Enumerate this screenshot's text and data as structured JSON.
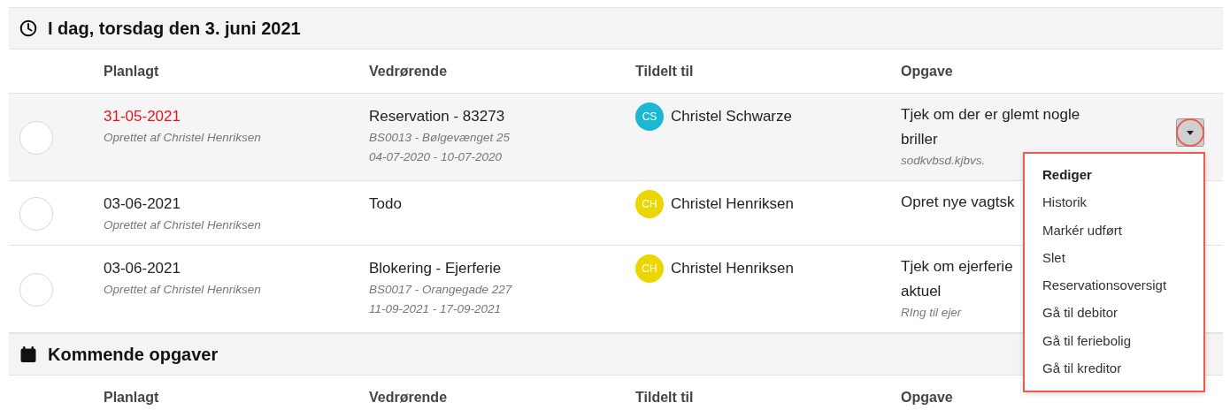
{
  "sections": [
    {
      "title": "I dag, torsdag den 3. juni 2021",
      "columns": [
        "Planlagt",
        "Vedrørende",
        "Tildelt til",
        "Opgave"
      ],
      "rows": [
        {
          "checked": false,
          "hovered": true,
          "date": "31-05-2021",
          "overdue": true,
          "created_by": "Oprettet af Christel Henriksen",
          "subject": "Reservation - 83273",
          "subject_details": [
            "BS0013 - Bølgevænget 25",
            "04-07-2020 - 10-07-2020"
          ],
          "assignee": {
            "initials": "CS",
            "name": "Christel Schwarze",
            "color": "#1bb8d6"
          },
          "task": "Tjek om der er glemt nogle briller",
          "task_note": "sodkvbsd.kjbvs."
        },
        {
          "checked": false,
          "date": "03-06-2021",
          "overdue": false,
          "created_by": "Oprettet af Christel Henriksen",
          "subject": "Todo",
          "subject_details": [],
          "assignee": {
            "initials": "CH",
            "name": "Christel Henriksen",
            "color": "#ecd600"
          },
          "task": "Opret nye vagtsk"
        },
        {
          "checked": false,
          "date": "03-06-2021",
          "overdue": false,
          "created_by": "Oprettet af Christel Henriksen",
          "subject": "Blokering - Ejerferie",
          "subject_details": [
            "BS0017 - Orangegade 227",
            "11-09-2021 - 17-09-2021"
          ],
          "assignee": {
            "initials": "CH",
            "name": "Christel Henriksen",
            "color": "#ecd600"
          },
          "task": "Tjek om ejerferie\naktuel",
          "task_note": "RIng til ejer"
        }
      ]
    },
    {
      "title": "Kommende opgaver",
      "columns": [
        "Planlagt",
        "Vedrørende",
        "Tildelt til",
        "Opgave"
      ]
    }
  ],
  "context_menu": {
    "items": [
      {
        "label": "Rediger",
        "kind": "primary"
      },
      {
        "label": "Historik",
        "kind": "item"
      },
      {
        "label": "Markér udført",
        "kind": "item"
      },
      {
        "label": "Slet",
        "kind": "item"
      },
      {
        "label": "Reservationsoversigt",
        "kind": "item"
      },
      {
        "label": "Gå til debitor",
        "kind": "item"
      },
      {
        "label": "Gå til feriebolig",
        "kind": "item"
      },
      {
        "label": "Gå til kreditor",
        "kind": "item"
      }
    ]
  }
}
